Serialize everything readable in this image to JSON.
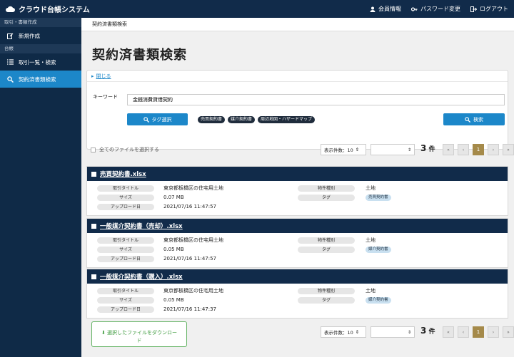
{
  "app": {
    "title": "クラウド台帳システム"
  },
  "header": {
    "member_info": "会員情報",
    "password_change": "パスワード変更",
    "logout": "ログアウト"
  },
  "sidebar": {
    "section1": "取引・書類作成",
    "new": "新規作成",
    "section2": "台帳",
    "list": "取引一覧・検索",
    "contract_search": "契約済書類検索"
  },
  "breadcrumb": "契約済書類検索",
  "page_title": "契約済書類検索",
  "search": {
    "toggle": "閉じる",
    "keyword_label": "キーワード",
    "keyword_value": "金銭消費貸借契約",
    "tag_button": "タグ選択",
    "tags": [
      "売買契約書",
      "媒介契約書",
      "周辺地図・ハザードマップ"
    ],
    "search_button": "検索"
  },
  "list": {
    "select_all": "全てのファイルを選択する",
    "per_page": "表示件数：10",
    "count": "3",
    "count_unit": "件",
    "page": "1",
    "download_line1": "選択したファイルをダウンロー",
    "download_line2": "ド"
  },
  "labels": {
    "title": "取引タイトル",
    "size": "サイズ",
    "upload": "アップロード日",
    "kind": "物件種別",
    "tag": "タグ"
  },
  "files": [
    {
      "name": "売買契約書.xlsx",
      "title": "東京都板橋区の住宅用土地",
      "size": "0.07 MB",
      "date": "2021/07/16 11:47:57",
      "kind": "土地",
      "tag": "売買契約書"
    },
    {
      "name": "一般媒介契約書（売却）.xlsx",
      "title": "東京都板橋区の住宅用土地",
      "size": "0.05 MB",
      "date": "2021/07/16 11:47:57",
      "kind": "土地",
      "tag": "媒介契約書"
    },
    {
      "name": "一般媒介契約書（購入）.xlsx",
      "title": "東京都板橋区の住宅用土地",
      "size": "0.05 MB",
      "date": "2021/07/16 11:47:37",
      "kind": "土地",
      "tag": "媒介契約書"
    }
  ]
}
